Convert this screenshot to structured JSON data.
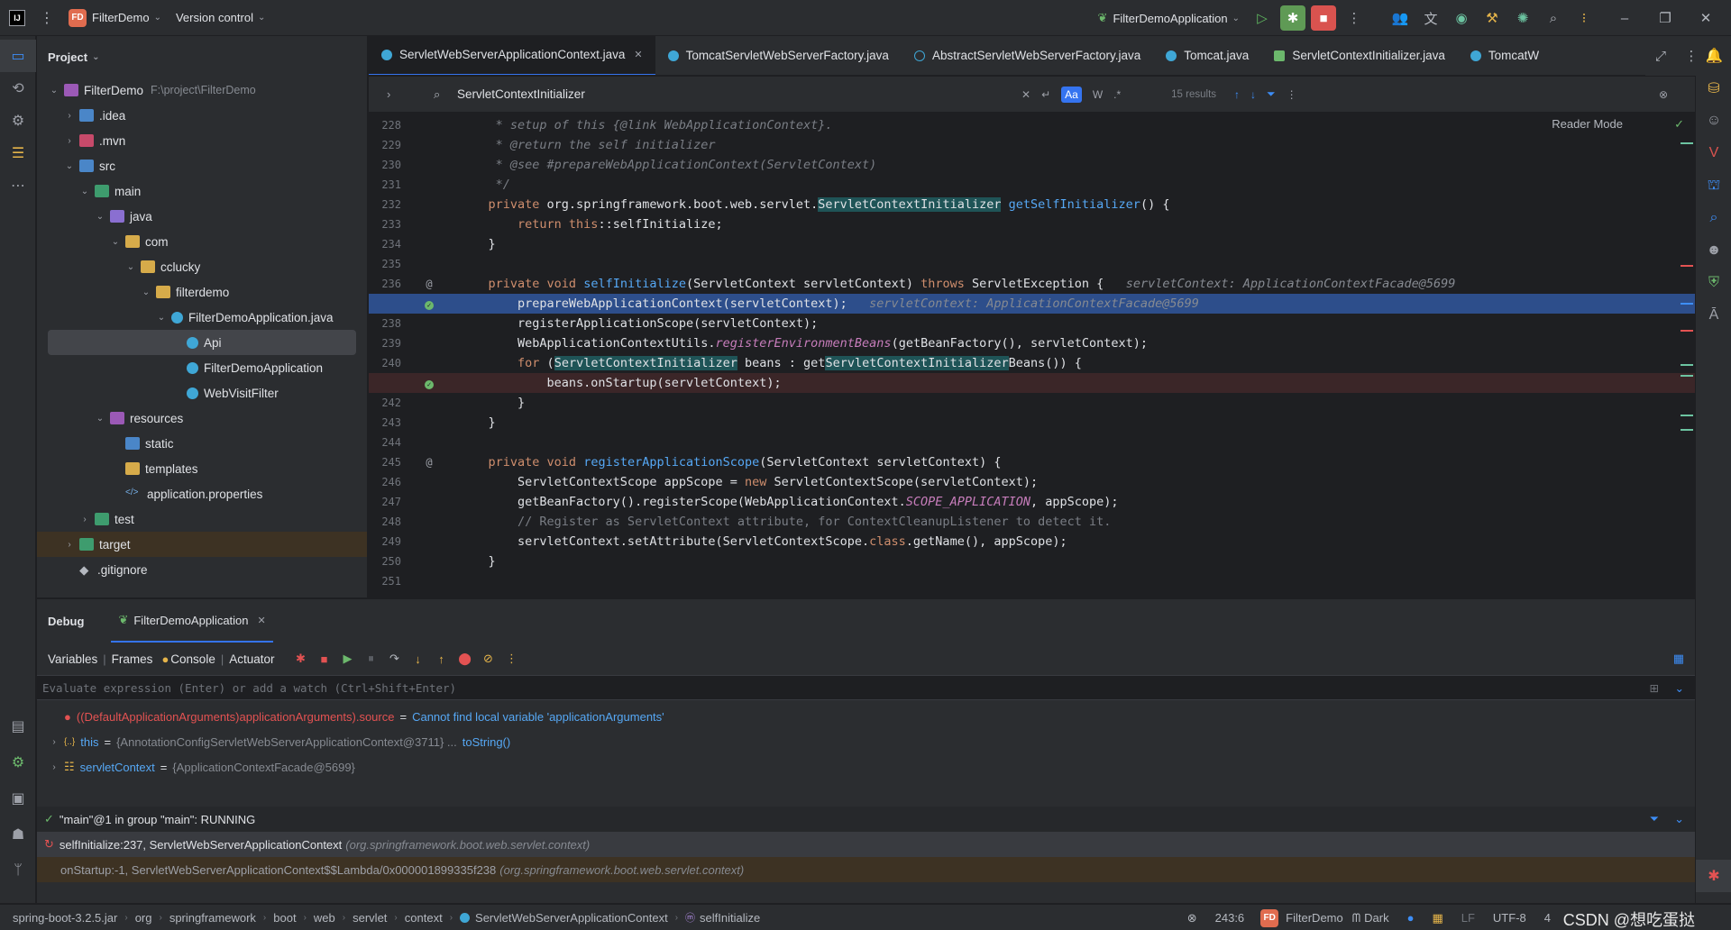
{
  "titlebar": {
    "project_badge": "FD",
    "project_name": "FilterDemo",
    "vcs": "Version control",
    "run_config": "FilterDemoApplication"
  },
  "project_panel": {
    "title": "Project",
    "tree": [
      {
        "label": "FilterDemo",
        "path": "F:\\project\\FilterDemo",
        "depth": 0,
        "arrow": "open",
        "icon": "res"
      },
      {
        "label": ".idea",
        "depth": 1,
        "arrow": "closed",
        "icon": "idea"
      },
      {
        "label": ".mvn",
        "depth": 1,
        "arrow": "closed",
        "icon": "mvn"
      },
      {
        "label": "src",
        "depth": 1,
        "arrow": "open",
        "icon": "src"
      },
      {
        "label": "main",
        "depth": 2,
        "arrow": "open",
        "icon": "test"
      },
      {
        "label": "java",
        "depth": 3,
        "arrow": "open",
        "icon": "java"
      },
      {
        "label": "com",
        "depth": 4,
        "arrow": "open",
        "icon": "folder"
      },
      {
        "label": "cclucky",
        "depth": 5,
        "arrow": "open",
        "icon": "folder"
      },
      {
        "label": "filterdemo",
        "depth": 6,
        "arrow": "open",
        "icon": "folder"
      },
      {
        "label": "FilterDemoApplication.java",
        "depth": 7,
        "arrow": "open",
        "icon": "class"
      },
      {
        "label": "Api",
        "depth": 8,
        "arrow": "",
        "icon": "class",
        "selected": true
      },
      {
        "label": "FilterDemoApplication",
        "depth": 8,
        "arrow": "",
        "icon": "class"
      },
      {
        "label": "WebVisitFilter",
        "depth": 8,
        "arrow": "",
        "icon": "class"
      },
      {
        "label": "resources",
        "depth": 3,
        "arrow": "open",
        "icon": "res"
      },
      {
        "label": "static",
        "depth": 4,
        "arrow": "",
        "icon": "src"
      },
      {
        "label": "templates",
        "depth": 4,
        "arrow": "",
        "icon": "folder"
      },
      {
        "label": "application.properties",
        "depth": 4,
        "arrow": "",
        "icon": "prop"
      },
      {
        "label": "test",
        "depth": 2,
        "arrow": "closed",
        "icon": "test"
      },
      {
        "label": "target",
        "depth": 1,
        "arrow": "closed",
        "icon": "target",
        "highlight": true
      },
      {
        "label": ".gitignore",
        "depth": 1,
        "arrow": "",
        "icon": "git"
      }
    ]
  },
  "tabs": [
    {
      "label": "ServletWebServerApplicationContext.java",
      "active": true
    },
    {
      "label": "TomcatServletWebServerFactory.java",
      "active": false
    },
    {
      "label": "AbstractServletWebServerFactory.java",
      "active": false
    },
    {
      "label": "Tomcat.java",
      "active": false
    },
    {
      "label": "ServletContextInitializer.java",
      "active": false
    },
    {
      "label": "TomcatW",
      "active": false
    }
  ],
  "search": {
    "query": "ServletContextInitializer",
    "opt_case": "Aa",
    "opt_word": "W",
    "opt_regex": ".*",
    "results": "15 results"
  },
  "editor": {
    "reader_mode": "Reader Mode",
    "lines": [
      {
        "n": "228",
        "html": "<span class='cm'>     * setup of this {@link WebApplicationContext}.</span>"
      },
      {
        "n": "229",
        "html": "<span class='cm'>     * @return the self initializer</span>"
      },
      {
        "n": "230",
        "html": "<span class='cm'>     * @see #prepareWebApplicationContext(ServletContext)</span>"
      },
      {
        "n": "231",
        "html": "<span class='cm'>     */</span>"
      },
      {
        "n": "232",
        "html": "    <span class='kw'>private</span> org.springframework.boot.web.servlet.<span class='mark'>ServletContextInitializer</span> <span class='fn'>getSelfInitializer</span>() {"
      },
      {
        "n": "233",
        "html": "        <span class='kw'>return this</span>::selfInitialize;"
      },
      {
        "n": "234",
        "html": "    }"
      },
      {
        "n": "235",
        "html": ""
      },
      {
        "n": "236",
        "gm": "@",
        "html": "    <span class='kw'>private void</span> <span class='fn'>selfInitialize</span>(ServletContext servletContext) <span class='kw'>throws</span> ServletException {   <span class='hint'>servletContext: ApplicationContextFacade@5699</span>"
      },
      {
        "n": "",
        "gm": "check",
        "exec": true,
        "html": "        prepareWebApplicationContext(servletContext);   <span class='hint'>servletContext: ApplicationContextFacade@5699</span>"
      },
      {
        "n": "238",
        "html": "        registerApplicationScope(servletContext);"
      },
      {
        "n": "239",
        "html": "        WebApplicationContextUtils.<span class='st'>registerEnvironmentBeans</span>(getBeanFactory(), servletContext);"
      },
      {
        "n": "240",
        "html": "        <span class='kw'>for</span> (<span class='mark'>ServletContextInitializer</span> beans : get<span class='mark'>ServletContextInitializer</span>Beans()) {"
      },
      {
        "n": "",
        "gm": "check",
        "bp": true,
        "html": "            beans.onStartup(servletContext);"
      },
      {
        "n": "242",
        "html": "        }"
      },
      {
        "n": "243",
        "html": "    }"
      },
      {
        "n": "244",
        "html": ""
      },
      {
        "n": "245",
        "gm": "@",
        "html": "    <span class='kw'>private void</span> <span class='fn'>registerApplicationScope</span>(ServletContext servletContext) {"
      },
      {
        "n": "246",
        "html": "        ServletContextScope appScope = <span class='kw'>new</span> ServletContextScope(servletContext);"
      },
      {
        "n": "247",
        "html": "        getBeanFactory().registerScope(WebApplicationContext.<span class='st' style='color:#c77dbb'>SCOPE_APPLICATION</span>, appScope);"
      },
      {
        "n": "248",
        "html": "<span class='cm' style='font-style:normal'>        // Register as ServletContext attribute, for ContextCleanupListener to detect it.</span>"
      },
      {
        "n": "249",
        "html": "        servletContext.setAttribute(ServletContextScope.<span class='kw'>class</span>.getName(), appScope);"
      },
      {
        "n": "250",
        "html": "    }"
      },
      {
        "n": "251",
        "html": ""
      }
    ]
  },
  "debug": {
    "title": "Debug",
    "session_tab": "FilterDemoApplication",
    "tools": [
      "Variables",
      "Frames",
      "Console",
      "Actuator"
    ],
    "eval_placeholder": "Evaluate expression (Enter) or add a watch (Ctrl+Shift+Enter)",
    "variables": [
      {
        "name": "((DefaultApplicationArguments)applicationArguments).source",
        "eq": "=",
        "value": "Cannot find local variable 'applicationArguments'",
        "kind": "error"
      },
      {
        "name": "this",
        "eq": "=",
        "value": "{AnnotationConfigServletWebServerApplicationContext@3711} ...",
        "link": "toString()",
        "kind": "object"
      },
      {
        "name": "servletContext",
        "eq": "=",
        "value": "{ApplicationContextFacade@5699}",
        "kind": "field"
      }
    ],
    "thread": "\"main\"@1 in group \"main\": RUNNING",
    "frames": [
      {
        "method": "selfInitialize:237, ServletWebServerApplicationContext",
        "pkg": "(org.springframework.boot.web.servlet.context)",
        "current": true
      },
      {
        "method": "onStartup:-1, ServletWebServerApplicationContext$$Lambda/0x000001899335f238",
        "pkg": "(org.springframework.boot.web.servlet.context)",
        "current": false
      }
    ]
  },
  "statusbar": {
    "crumbs": [
      "spring-boot-3.2.5.jar",
      "org",
      "springframework",
      "boot",
      "web",
      "servlet",
      "context",
      "ServletWebServerApplicationContext",
      "selfInitialize"
    ],
    "position": "243:6",
    "project_badge": "FD",
    "project": "FilterDemo",
    "theme": "Dark",
    "line_sep": "LF",
    "encoding": "UTF-8",
    "indent": "4",
    "watermark": "CSDN @想吃蛋挞"
  }
}
